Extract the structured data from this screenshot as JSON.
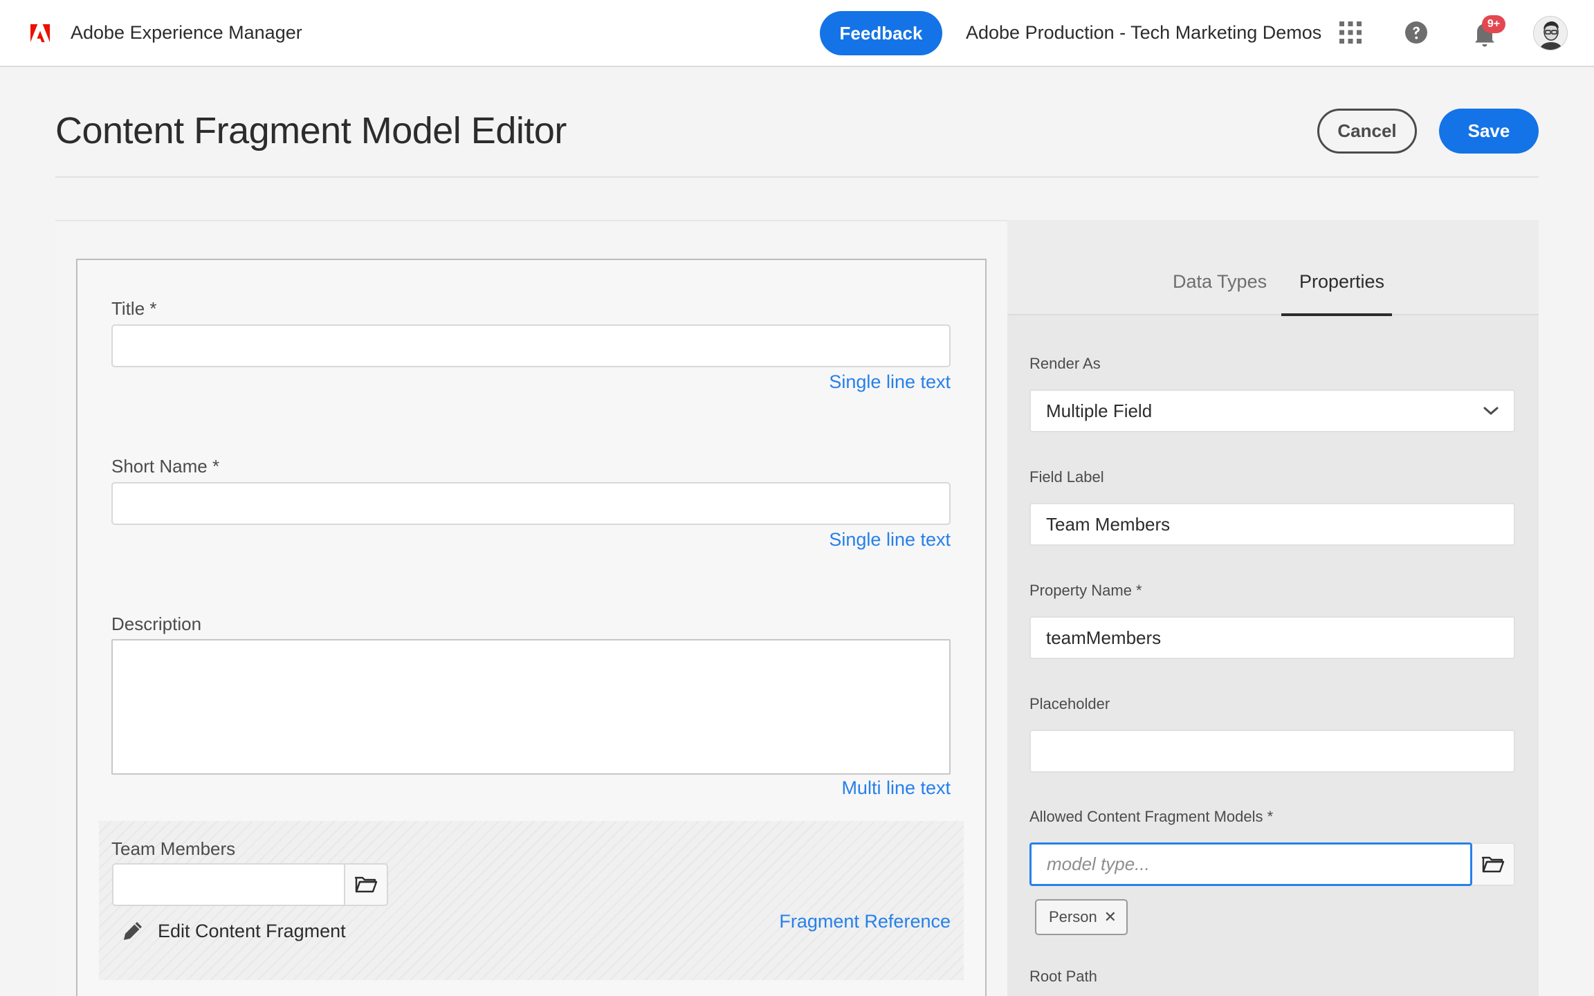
{
  "header": {
    "app_name": "Adobe Experience Manager",
    "feedback_label": "Feedback",
    "org_name": "Adobe Production - Tech Marketing Demos",
    "notification_count": "9+",
    "icons": [
      "adobe-logo",
      "apps-grid-icon",
      "help-icon",
      "bell-icon",
      "avatar"
    ]
  },
  "page": {
    "title": "Content Fragment Model Editor",
    "cancel_label": "Cancel",
    "save_label": "Save"
  },
  "model_fields": [
    {
      "label": "Title *",
      "value": "",
      "type": "Single line text"
    },
    {
      "label": "Short Name *",
      "value": "",
      "type": "Single line text"
    },
    {
      "label": "Description",
      "value": "",
      "type": "Multi line text"
    },
    {
      "label": "Team Members",
      "value": "",
      "type": "Fragment Reference",
      "action": "Edit Content Fragment"
    }
  ],
  "side_panel": {
    "tabs": [
      "Data Types",
      "Properties"
    ],
    "active_tab": "Properties",
    "render_as_label": "Render As",
    "render_as_value": "Multiple Field",
    "field_label_label": "Field Label",
    "field_label_value": "Team Members",
    "property_name_label": "Property Name *",
    "property_name_value": "teamMembers",
    "placeholder_label": "Placeholder",
    "placeholder_value": "",
    "allowed_models_label": "Allowed Content Fragment Models *",
    "allowed_models_placeholder": "model type...",
    "allowed_models_tags": [
      "Person"
    ],
    "root_path_label": "Root Path"
  },
  "colors": {
    "accent": "#1473e6",
    "link": "#2680eb",
    "badge": "#e34850",
    "adobe_red": "#eb1000"
  }
}
